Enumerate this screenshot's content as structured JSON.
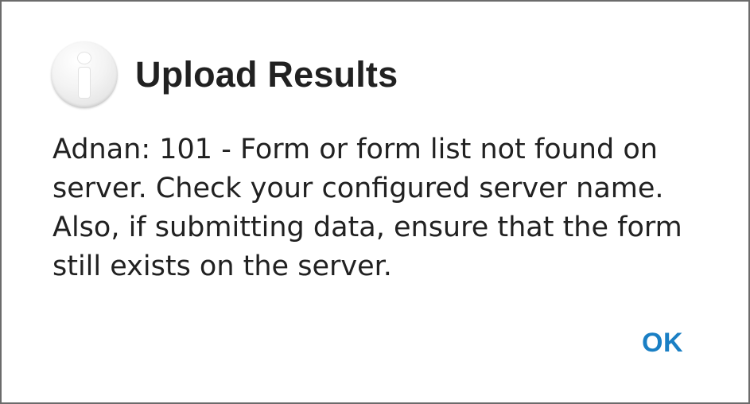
{
  "dialog": {
    "icon": "info-icon",
    "title": "Upload Results",
    "message": "Adnan: 101 - Form or form list not found on server. Check your configured server name. Also, if submitting data, ensure that the form still exists on the server.",
    "ok_label": "OK"
  },
  "colors": {
    "accent": "#1a7fc4",
    "text": "#212121",
    "background": "#ffffff"
  }
}
